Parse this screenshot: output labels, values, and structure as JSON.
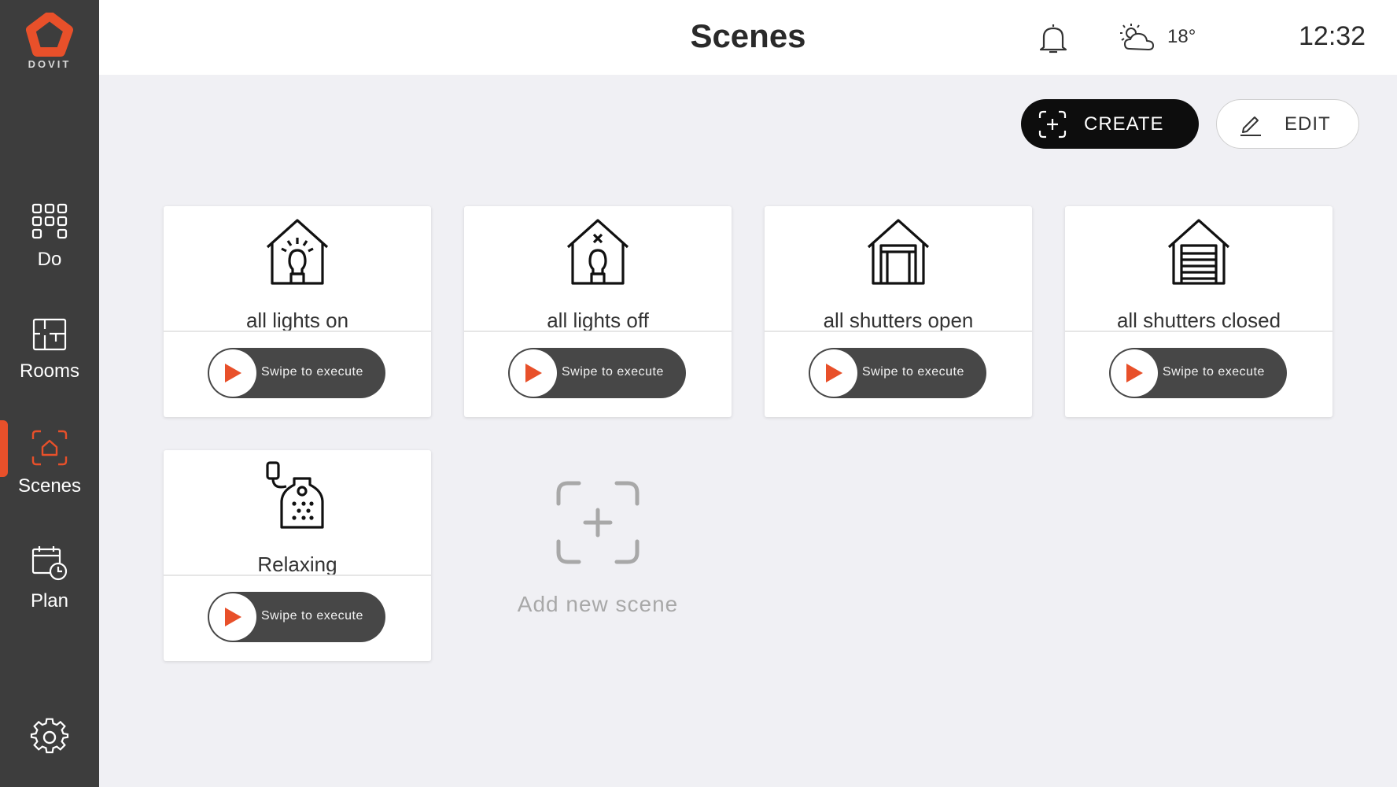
{
  "brand": {
    "name": "DOVIT",
    "accent": "#e8502a"
  },
  "sidebar": {
    "items": [
      {
        "label": "Do",
        "icon": "grid-icon"
      },
      {
        "label": "Rooms",
        "icon": "floorplan-icon"
      },
      {
        "label": "Scenes",
        "icon": "scenes-icon",
        "active": true
      },
      {
        "label": "Plan",
        "icon": "calendar-clock-icon"
      }
    ],
    "settings_icon": "gear-icon"
  },
  "header": {
    "title": "Scenes",
    "temperature": "18°",
    "time": "12:32"
  },
  "actions": {
    "create_label": "CREATE",
    "edit_label": "EDIT"
  },
  "scenes": [
    {
      "name": "all lights on",
      "icon": "house-light-on-icon",
      "swipe_label": "Swipe to execute"
    },
    {
      "name": "all lights off",
      "icon": "house-light-off-icon",
      "swipe_label": "Swipe to execute"
    },
    {
      "name": "all shutters open",
      "icon": "shutter-open-icon",
      "swipe_label": "Swipe to execute"
    },
    {
      "name": "all shutters closed",
      "icon": "shutter-closed-icon",
      "swipe_label": "Swipe to execute"
    },
    {
      "name": "Relaxing",
      "icon": "relax-tag-icon",
      "swipe_label": "Swipe to execute"
    }
  ],
  "add_scene": {
    "label": "Add new scene"
  }
}
